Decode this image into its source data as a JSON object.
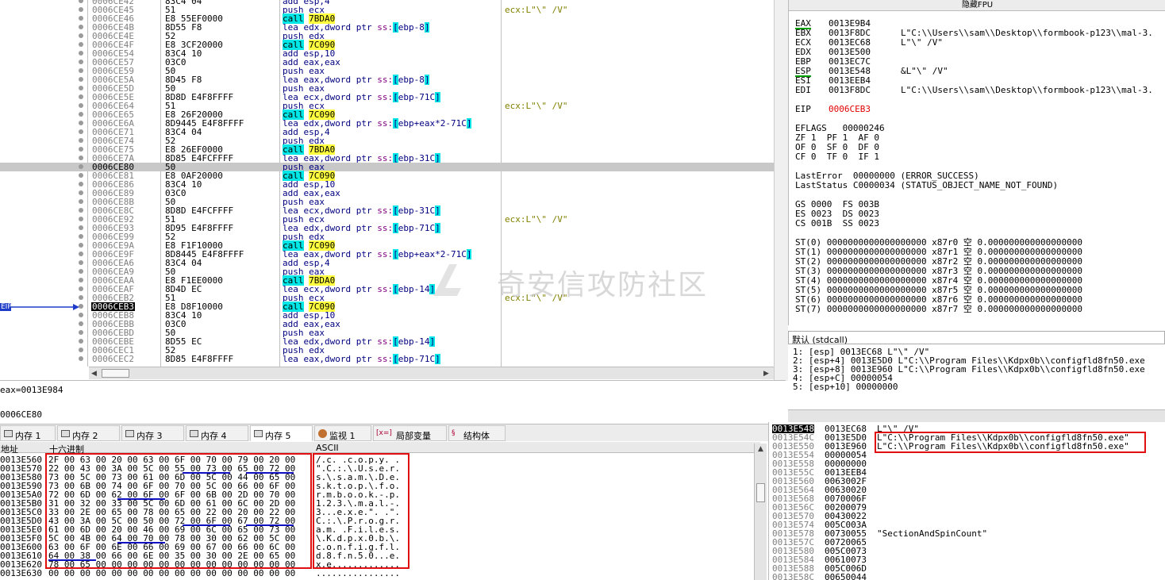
{
  "disasm": {
    "rows": [
      {
        "addr": "0006CE42",
        "hex": "83C4 04",
        "asm": "add esp,4",
        "cmt": ""
      },
      {
        "addr": "0006CE45",
        "hex": "51",
        "asm": "push ecx",
        "cmt": "ecx:L\"\\\" /V\""
      },
      {
        "addr": "0006CE46",
        "hex": "E8 55EF0000",
        "asm": "call 7BDA0",
        "cmt": ""
      },
      {
        "addr": "0006CE4B",
        "hex": "8D55 F8",
        "asm": "lea edx,dword ptr ss:[ebp-8]",
        "cmt": ""
      },
      {
        "addr": "0006CE4E",
        "hex": "52",
        "asm": "push edx",
        "cmt": ""
      },
      {
        "addr": "0006CE4F",
        "hex": "E8 3CF20000",
        "asm": "call 7C090",
        "cmt": ""
      },
      {
        "addr": "0006CE54",
        "hex": "83C4 10",
        "asm": "add esp,10",
        "cmt": ""
      },
      {
        "addr": "0006CE57",
        "hex": "03C0",
        "asm": "add eax,eax",
        "cmt": ""
      },
      {
        "addr": "0006CE59",
        "hex": "50",
        "asm": "push eax",
        "cmt": ""
      },
      {
        "addr": "0006CE5A",
        "hex": "8D45 F8",
        "asm": "lea eax,dword ptr ss:[ebp-8]",
        "cmt": ""
      },
      {
        "addr": "0006CE5D",
        "hex": "50",
        "asm": "push eax",
        "cmt": ""
      },
      {
        "addr": "0006CE5E",
        "hex": "8D8D E4F8FFFF",
        "asm": "lea ecx,dword ptr ss:[ebp-71C]",
        "cmt": ""
      },
      {
        "addr": "0006CE64",
        "hex": "51",
        "asm": "push ecx",
        "cmt": "ecx:L\"\\\" /V\""
      },
      {
        "addr": "0006CE65",
        "hex": "E8 26F20000",
        "asm": "call 7C090",
        "cmt": ""
      },
      {
        "addr": "0006CE6A",
        "hex": "8D9445 E4F8FFFF",
        "asm": "lea edx,dword ptr ss:[ebp+eax*2-71C]",
        "cmt": ""
      },
      {
        "addr": "0006CE71",
        "hex": "83C4 04",
        "asm": "add esp,4",
        "cmt": ""
      },
      {
        "addr": "0006CE74",
        "hex": "52",
        "asm": "push edx",
        "cmt": ""
      },
      {
        "addr": "0006CE75",
        "hex": "E8 26EF0000",
        "asm": "call 7BDA0",
        "cmt": ""
      },
      {
        "addr": "0006CE7A",
        "hex": "8D85 E4FCFFFF",
        "asm": "lea eax,dword ptr ss:[ebp-31C]",
        "cmt": ""
      },
      {
        "addr": "0006CE80",
        "hex": "50",
        "asm": "push eax",
        "cmt": ""
      },
      {
        "addr": "0006CE81",
        "hex": "E8 0AF20000",
        "asm": "call 7C090",
        "cmt": ""
      },
      {
        "addr": "0006CE86",
        "hex": "83C4 10",
        "asm": "add esp,10",
        "cmt": ""
      },
      {
        "addr": "0006CE89",
        "hex": "03C0",
        "asm": "add eax,eax",
        "cmt": ""
      },
      {
        "addr": "0006CE8B",
        "hex": "50",
        "asm": "push eax",
        "cmt": ""
      },
      {
        "addr": "0006CE8C",
        "hex": "8D8D E4FCFFFF",
        "asm": "lea ecx,dword ptr ss:[ebp-31C]",
        "cmt": ""
      },
      {
        "addr": "0006CE92",
        "hex": "51",
        "asm": "push ecx",
        "cmt": "ecx:L\"\\\" /V\""
      },
      {
        "addr": "0006CE93",
        "hex": "8D95 E4F8FFFF",
        "asm": "lea edx,dword ptr ss:[ebp-71C]",
        "cmt": ""
      },
      {
        "addr": "0006CE99",
        "hex": "52",
        "asm": "push edx",
        "cmt": ""
      },
      {
        "addr": "0006CE9A",
        "hex": "E8 F1F10000",
        "asm": "call 7C090",
        "cmt": ""
      },
      {
        "addr": "0006CE9F",
        "hex": "8D8445 E4F8FFFF",
        "asm": "lea eax,dword ptr ss:[ebp+eax*2-71C]",
        "cmt": ""
      },
      {
        "addr": "0006CEA6",
        "hex": "83C4 04",
        "asm": "add esp,4",
        "cmt": ""
      },
      {
        "addr": "0006CEA9",
        "hex": "50",
        "asm": "push eax",
        "cmt": ""
      },
      {
        "addr": "0006CEAA",
        "hex": "E8 F1EE0000",
        "asm": "call 7BDA0",
        "cmt": ""
      },
      {
        "addr": "0006CEAF",
        "hex": "8D4D EC",
        "asm": "lea ecx,dword ptr ss:[ebp-14]",
        "cmt": ""
      },
      {
        "addr": "0006CEB2",
        "hex": "51",
        "asm": "push ecx",
        "cmt": "ecx:L\"\\\" /V\""
      },
      {
        "addr": "0006CEB3",
        "hex": "E8 D8F10000",
        "asm": "call 7C090",
        "cmt": ""
      },
      {
        "addr": "0006CEB8",
        "hex": "83C4 10",
        "asm": "add esp,10",
        "cmt": ""
      },
      {
        "addr": "0006CEBB",
        "hex": "03C0",
        "asm": "add eax,eax",
        "cmt": ""
      },
      {
        "addr": "0006CEBD",
        "hex": "50",
        "asm": "push eax",
        "cmt": ""
      },
      {
        "addr": "0006CEBE",
        "hex": "8D55 EC",
        "asm": "lea edx,dword ptr ss:[ebp-14]",
        "cmt": ""
      },
      {
        "addr": "0006CEC1",
        "hex": "52",
        "asm": "push edx",
        "cmt": ""
      },
      {
        "addr": "0006CEC2",
        "hex": "8D85 E4F8FFFF",
        "asm": "lea eax,dword ptr ss:[ebp-71C]",
        "cmt": ""
      }
    ],
    "selected_index": 19,
    "eip_index": 35,
    "eip_label": "EIP"
  },
  "info": {
    "line1": "eax=0013E984",
    "line2": "0006CE80"
  },
  "tabs": [
    {
      "label": "内存 1"
    },
    {
      "label": "内存 2"
    },
    {
      "label": "内存 3"
    },
    {
      "label": "内存 4"
    },
    {
      "label": "内存 5"
    },
    {
      "label": "监视 1"
    },
    {
      "label": "局部变量",
      "prefix": "[x=]"
    },
    {
      "label": "结构体"
    }
  ],
  "active_tab": 4,
  "dump": {
    "header": {
      "addr": "地址",
      "hex": "十六进制",
      "ascii": "ASCII"
    },
    "rows": [
      {
        "addr": "0013E560",
        "hex": "2F 00 63 00 20 00 63 00 6F 00 70 00 79 00 20 00",
        "ascii": "/.c. .c.o.p.y. ."
      },
      {
        "addr": "0013E570",
        "hex": "22 00 43 00 3A 00 5C 00 55 00 73 00 65 00 72 00",
        "ascii": "\".C.:.\\.U.s.e.r."
      },
      {
        "addr": "0013E580",
        "hex": "73 00 5C 00 73 00 61 00 6D 00 5C 00 44 00 65 00",
        "ascii": "s.\\.s.a.m.\\.D.e."
      },
      {
        "addr": "0013E590",
        "hex": "73 00 6B 00 74 00 6F 00 70 00 5C 00 66 00 6F 00",
        "ascii": "s.k.t.o.p.\\.f.o."
      },
      {
        "addr": "0013E5A0",
        "hex": "72 00 6D 00 62 00 6F 00 6F 00 6B 00 2D 00 70 00",
        "ascii": "r.m.b.o.o.k.-.p."
      },
      {
        "addr": "0013E5B0",
        "hex": "31 00 32 00 33 00 5C 00 6D 00 61 00 6C 00 2D 00",
        "ascii": "1.2.3.\\.m.a.l.-."
      },
      {
        "addr": "0013E5C0",
        "hex": "33 00 2E 00 65 00 78 00 65 00 22 00 20 00 22 00",
        "ascii": "3...e.x.e.\". .\"."
      },
      {
        "addr": "0013E5D0",
        "hex": "43 00 3A 00 5C 00 50 00 72 00 6F 00 67 00 72 00",
        "ascii": "C.:.\\.P.r.o.g.r."
      },
      {
        "addr": "0013E5E0",
        "hex": "61 00 6D 00 20 00 46 00 69 00 6C 00 65 00 73 00",
        "ascii": "a.m. .F.i.l.e.s."
      },
      {
        "addr": "0013E5F0",
        "hex": "5C 00 4B 00 64 00 70 00 78 00 30 00 62 00 5C 00",
        "ascii": "\\.K.d.p.x.0.b.\\."
      },
      {
        "addr": "0013E600",
        "hex": "63 00 6F 00 6E 00 66 00 69 00 67 00 66 00 6C 00",
        "ascii": "c.o.n.f.i.g.f.l."
      },
      {
        "addr": "0013E610",
        "hex": "64 00 38 00 66 00 6E 00 35 00 30 00 2E 00 65 00",
        "ascii": "d.8.f.n.5.0...e."
      },
      {
        "addr": "0013E620",
        "hex": "78 00 65 00 00 00 00 00 00 00 00 00 00 00 00 00",
        "ascii": "x.e............."
      },
      {
        "addr": "0013E630",
        "hex": "00 00 00 00 00 00 00 00 00 00 00 00 00 00 00 00",
        "ascii": "................"
      }
    ]
  },
  "fpu": {
    "title": "隐藏FPU",
    "regs": [
      {
        "n": "EAX",
        "v": "0013E9B4",
        "c": ""
      },
      {
        "n": "EBX",
        "v": "0013F8DC",
        "c": "L\"C:\\\\Users\\\\sam\\\\Desktop\\\\formbook-p123\\\\mal-3."
      },
      {
        "n": "ECX",
        "v": "0013EC68",
        "c": "L\"\\\" /V\""
      },
      {
        "n": "EDX",
        "v": "0013E500",
        "c": ""
      },
      {
        "n": "EBP",
        "v": "0013EC7C",
        "c": ""
      },
      {
        "n": "ESP",
        "v": "0013E548",
        "c": "&L\"\\\" /V\""
      },
      {
        "n": "ESI",
        "v": "0013EEB4",
        "c": ""
      },
      {
        "n": "EDI",
        "v": "0013F8DC",
        "c": "L\"C:\\\\Users\\\\sam\\\\Desktop\\\\formbook-p123\\\\mal-3."
      }
    ],
    "eip": {
      "n": "EIP",
      "v": "0006CEB3"
    },
    "eflags": "EFLAGS   00000246",
    "flags": [
      "ZF 1  PF 1  AF 0",
      "OF 0  SF 0  DF 0",
      "CF 0  TF 0  IF 1"
    ],
    "lasterror": "LastError  00000000 (ERROR_SUCCESS)",
    "laststatus": "LastStatus C0000034 (STATUS_OBJECT_NAME_NOT_FOUND)",
    "segs": [
      "GS 0000  FS 003B",
      "ES 0023  DS 0023",
      "CS 001B  SS 0023"
    ],
    "st": [
      "ST(0) 0000000000000000000 x87r0 空 0.000000000000000000",
      "ST(1) 0000000000000000000 x87r1 空 0.000000000000000000",
      "ST(2) 0000000000000000000 x87r2 空 0.000000000000000000",
      "ST(3) 0000000000000000000 x87r3 空 0.000000000000000000",
      "ST(4) 0000000000000000000 x87r4 空 0.000000000000000000",
      "ST(5) 0000000000000000000 x87r5 空 0.000000000000000000",
      "ST(6) 0000000000000000000 x87r6 空 0.000000000000000000",
      "ST(7) 0000000000000000000 x87r7 空 0.000000000000000000"
    ]
  },
  "callconv": {
    "label": "默认 (stdcall)",
    "rows": [
      "1: [esp] 0013EC68 L\"\\\" /V\"",
      "2: [esp+4] 0013E5D0 L\"C:\\\\Program Files\\\\Kdpx0b\\\\configfld8fn50.exe",
      "3: [esp+8] 0013E960 L\"C:\\\\Program Files\\\\Kdpx0b\\\\configfld8fn50.exe",
      "4: [esp+C] 00000054",
      "5: [esp+10] 00000000"
    ]
  },
  "stack": {
    "rows": [
      {
        "a": "0013E548",
        "v": "0013EC68",
        "c": "L\"\\\" /V\""
      },
      {
        "a": "0013E54C",
        "v": "0013E5D0",
        "c": "L\"C:\\\\Program Files\\\\Kdpx0b\\\\configfld8fn50.exe\""
      },
      {
        "a": "0013E550",
        "v": "0013E960",
        "c": "L\"C:\\\\Program Files\\\\Kdpx0b\\\\configfld8fn50.exe\""
      },
      {
        "a": "0013E554",
        "v": "00000054",
        "c": ""
      },
      {
        "a": "0013E558",
        "v": "00000000",
        "c": ""
      },
      {
        "a": "0013E55C",
        "v": "0013EEB4",
        "c": ""
      },
      {
        "a": "0013E560",
        "v": "0063002F",
        "c": ""
      },
      {
        "a": "0013E564",
        "v": "00630020",
        "c": ""
      },
      {
        "a": "0013E568",
        "v": "0070006F",
        "c": ""
      },
      {
        "a": "0013E56C",
        "v": "00200079",
        "c": ""
      },
      {
        "a": "0013E570",
        "v": "00430022",
        "c": ""
      },
      {
        "a": "0013E574",
        "v": "005C003A",
        "c": ""
      },
      {
        "a": "0013E578",
        "v": "00730055",
        "c": "\"SectionAndSpinCount\""
      },
      {
        "a": "0013E57C",
        "v": "00720065",
        "c": ""
      },
      {
        "a": "0013E580",
        "v": "005C0073",
        "c": ""
      },
      {
        "a": "0013E584",
        "v": "00610073",
        "c": ""
      },
      {
        "a": "0013E588",
        "v": "005C006D",
        "c": ""
      },
      {
        "a": "0013E58C",
        "v": "00650044",
        "c": ""
      }
    ]
  },
  "watermark": "奇安信攻防社区"
}
